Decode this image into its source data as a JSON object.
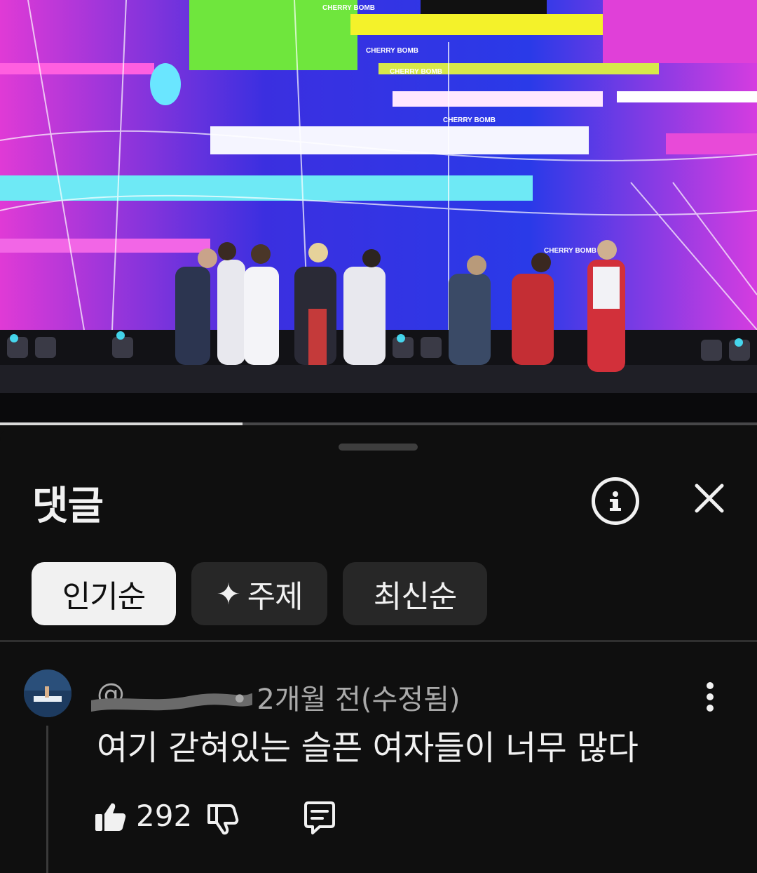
{
  "video": {
    "scene": "concert-stage-performance",
    "stage_text": [
      "CHERRY BOMB",
      "CHERRY BOMB",
      "CHERRY BOMB",
      "CHERRY BOMB",
      "CHERRY BOMB"
    ],
    "progress_fraction": 0.32,
    "colors": {
      "magenta": "#e83fd8",
      "blue": "#2a2fd6",
      "cyan": "#3fe6f2",
      "lime": "#7ff04a"
    }
  },
  "comments_panel": {
    "title": "댓글",
    "info_icon": "info-icon",
    "close_icon": "close-icon",
    "sort_chips": [
      {
        "label": "인기순",
        "active": true
      },
      {
        "label": "주제",
        "icon": "sparkle-icon",
        "active": false
      },
      {
        "label": "최신순",
        "active": false
      }
    ]
  },
  "comment": {
    "handle": "@",
    "timestamp": "2개월 전(수정됨)",
    "text": "여기 갇혀있는 슬픈 여자들이 너무 많다",
    "like_count": "292",
    "icons": [
      "like-icon",
      "dislike-icon",
      "reply-icon",
      "more-vertical-icon"
    ]
  },
  "colors": {
    "background": "#0f0f0f",
    "chip_active": "#f1f1f1",
    "chip_inactive": "#272727",
    "text_primary": "#f1f1f1",
    "text_secondary": "#aaaaaa"
  }
}
